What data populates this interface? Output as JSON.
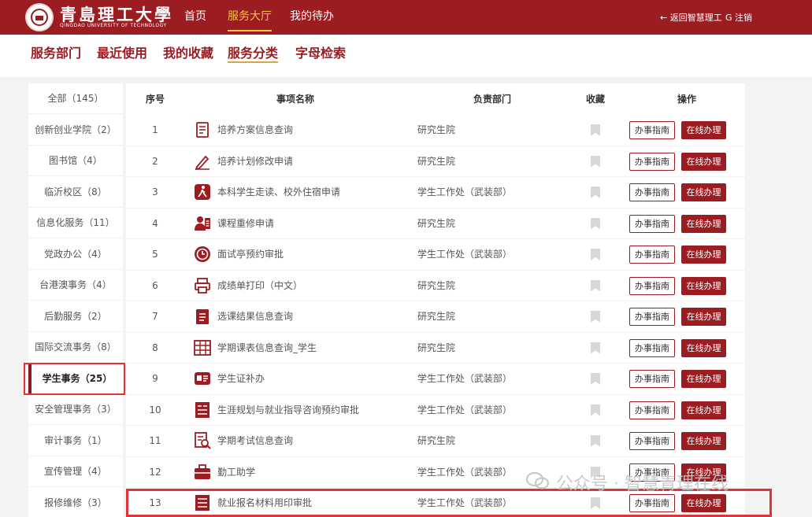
{
  "header": {
    "university_name": "青島理工大學",
    "university_subtitle": "QINGDAO UNIVERSITY OF TECHNOLOGY",
    "nav": [
      {
        "label": "首页"
      },
      {
        "label": "服务大厅"
      },
      {
        "label": "我的待办"
      }
    ],
    "return_label": "← 返回智慧理工",
    "logout_label": "G 注销"
  },
  "subnav": {
    "tabs": [
      {
        "label": "服务部门"
      },
      {
        "label": "最近使用"
      },
      {
        "label": "我的收藏"
      },
      {
        "label": "服务分类"
      },
      {
        "label": "字母检索"
      }
    ]
  },
  "sidebar": {
    "items": [
      {
        "label": "全部（145）"
      },
      {
        "label": "创新创业学院（2）"
      },
      {
        "label": "图书馆（4）"
      },
      {
        "label": "临沂校区（8）"
      },
      {
        "label": "信息化服务（11）"
      },
      {
        "label": "党政办公（4）"
      },
      {
        "label": "台港澳事务（4）"
      },
      {
        "label": "后勤服务（2）"
      },
      {
        "label": "国际交流事务（8）"
      },
      {
        "label": "学生事务（25）"
      },
      {
        "label": "安全管理事务（3）"
      },
      {
        "label": "审计事务（1）"
      },
      {
        "label": "宣传管理（4）"
      },
      {
        "label": "报修维修（3）"
      }
    ]
  },
  "table": {
    "headers": {
      "num": "序号",
      "name": "事项名称",
      "dept": "负责部门",
      "fav": "收藏",
      "ops": "操作"
    },
    "guide_label": "办事指南",
    "online_label": "在线办理",
    "rows": [
      {
        "num": "1",
        "name": "培养方案信息查询",
        "dept": "研究生院",
        "icon": "document-icon"
      },
      {
        "num": "2",
        "name": "培养计划修改申请",
        "dept": "研究生院",
        "icon": "pencil-icon"
      },
      {
        "num": "3",
        "name": "本科学生走读、校外住宿申请",
        "dept": "学生工作处（武装部）",
        "icon": "walking-icon"
      },
      {
        "num": "4",
        "name": "课程重修申请",
        "dept": "研究生院",
        "icon": "person-icon"
      },
      {
        "num": "5",
        "name": "面试亭预约审批",
        "dept": "学生工作处（武装部）",
        "icon": "clock-icon"
      },
      {
        "num": "6",
        "name": "成绩单打印（中文）",
        "dept": "研究生院",
        "icon": "printer-icon"
      },
      {
        "num": "7",
        "name": "选课结果信息查询",
        "dept": "研究生院",
        "icon": "list-icon"
      },
      {
        "num": "8",
        "name": "学期课表信息查询_学生",
        "dept": "研究生院",
        "icon": "calendar-icon"
      },
      {
        "num": "9",
        "name": "学生证补办",
        "dept": "学生工作处（武装部）",
        "icon": "id-card-icon"
      },
      {
        "num": "10",
        "name": "生涯规划与就业指导咨询预约审批",
        "dept": "学生工作处（武装部）",
        "icon": "career-icon"
      },
      {
        "num": "11",
        "name": "学期考试信息查询",
        "dept": "研究生院",
        "icon": "search-doc-icon"
      },
      {
        "num": "12",
        "name": "勤工助学",
        "dept": "学生工作处（武装部）",
        "icon": "briefcase-icon"
      },
      {
        "num": "13",
        "name": "就业报名材料用印审批",
        "dept": "学生工作处（武装部）",
        "icon": "stamp-icon"
      }
    ]
  },
  "watermark": {
    "text": "公众号 · 智慧青理在线"
  },
  "colors": {
    "brand": "#9b1c21",
    "accent": "#f5c443",
    "highlight": "#e0333a"
  }
}
